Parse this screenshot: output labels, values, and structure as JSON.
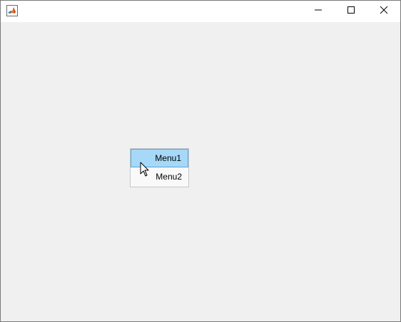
{
  "window": {
    "app_icon": "matlab-figure-icon",
    "controls": {
      "minimize_icon": "minimize-icon",
      "maximize_icon": "maximize-icon",
      "close_icon": "close-icon"
    }
  },
  "context_menu": {
    "items": [
      {
        "label": "Menu1",
        "highlighted": true
      },
      {
        "label": "Menu2",
        "highlighted": false
      }
    ]
  },
  "colors": {
    "client_bg": "#f0f0f0",
    "titlebar_bg": "#ffffff",
    "menu_highlight": "#a6d8f8",
    "menu_highlight_border": "#5aa6d6",
    "menu_bg": "#f9f9f9"
  },
  "pointer": {
    "icon": "arrow-cursor-icon"
  }
}
